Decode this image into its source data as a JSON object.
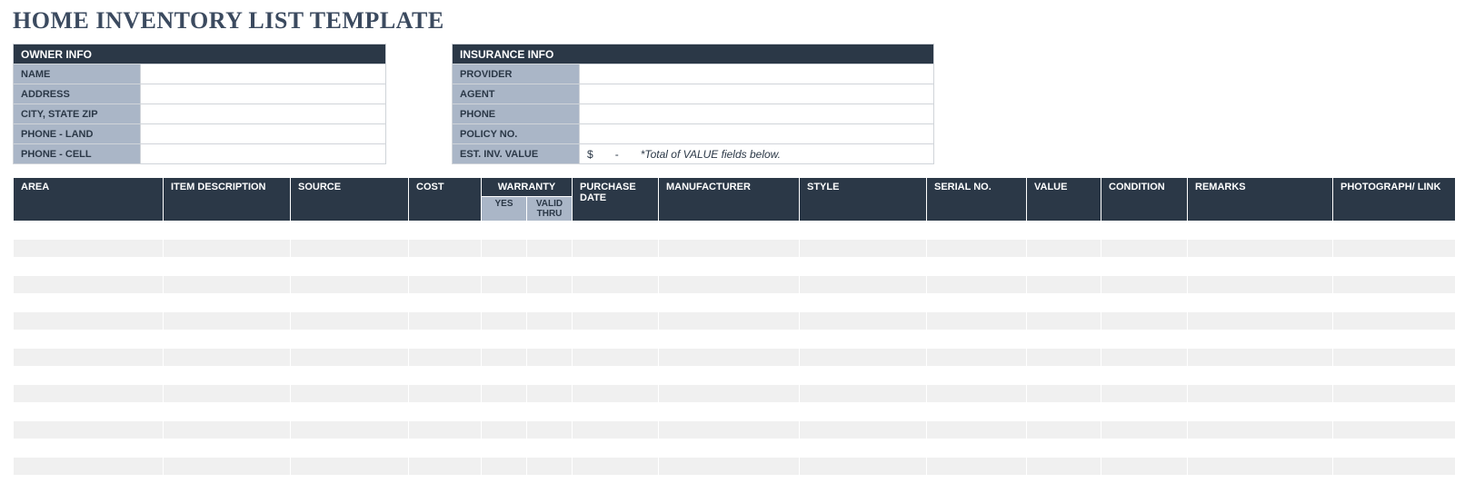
{
  "title": "HOME INVENTORY LIST TEMPLATE",
  "ownerInfo": {
    "header": "OWNER INFO",
    "labels": {
      "name": "NAME",
      "address": "ADDRESS",
      "cityStateZip": "CITY, STATE ZIP",
      "phoneLand": "PHONE - LAND",
      "phoneCell": "PHONE - CELL"
    },
    "values": {
      "name": "",
      "address": "",
      "cityStateZip": "",
      "phoneLand": "",
      "phoneCell": ""
    }
  },
  "insuranceInfo": {
    "header": "INSURANCE INFO",
    "labels": {
      "provider": "PROVIDER",
      "agent": "AGENT",
      "phone": "PHONE",
      "policyNo": "POLICY NO.",
      "estInvValue": "EST. INV. VALUE"
    },
    "values": {
      "provider": "",
      "agent": "",
      "phone": "",
      "policyNo": "",
      "estCurrency": "$",
      "estAmount": "-",
      "estNote": "*Total of VALUE fields below."
    }
  },
  "columns": {
    "area": "AREA",
    "item": "ITEM DESCRIPTION",
    "source": "SOURCE",
    "cost": "COST",
    "warranty": "WARRANTY",
    "warrantyYes": "YES",
    "warrantyThru": "VALID THRU",
    "purchaseDate": "PURCHASE DATE",
    "manufacturer": "MANUFACTURER",
    "style": "STYLE",
    "serial": "SERIAL NO.",
    "value": "VALUE",
    "condition": "CONDITION",
    "remarks": "REMARKS",
    "photo": "PHOTOGRAPH/ LINK"
  },
  "rows": [
    {},
    {},
    {},
    {},
    {},
    {},
    {},
    {},
    {},
    {},
    {},
    {},
    {},
    {}
  ]
}
